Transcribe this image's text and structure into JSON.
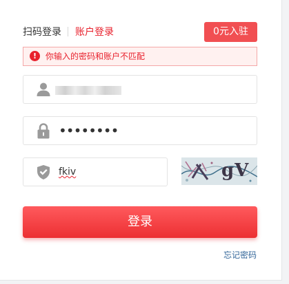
{
  "tabs": {
    "qr_login": "扫码登录",
    "account_login": "账户登录"
  },
  "register_button": "0元入驻",
  "error": {
    "icon": "exclamation-icon",
    "message": "你输入的密码和账户不匹配"
  },
  "username": {
    "icon": "user-icon",
    "value_visibility": "blurred"
  },
  "password": {
    "icon": "lock-icon",
    "masked_value": "••••••••"
  },
  "captcha": {
    "icon": "shield-icon",
    "value": "fkiv",
    "image_text": "gV"
  },
  "login_button": "登录",
  "forgot_password": "忘记密码",
  "colors": {
    "accent_red": "#e8212d",
    "register_bg": "#f14f52",
    "link_blue": "#336699"
  }
}
